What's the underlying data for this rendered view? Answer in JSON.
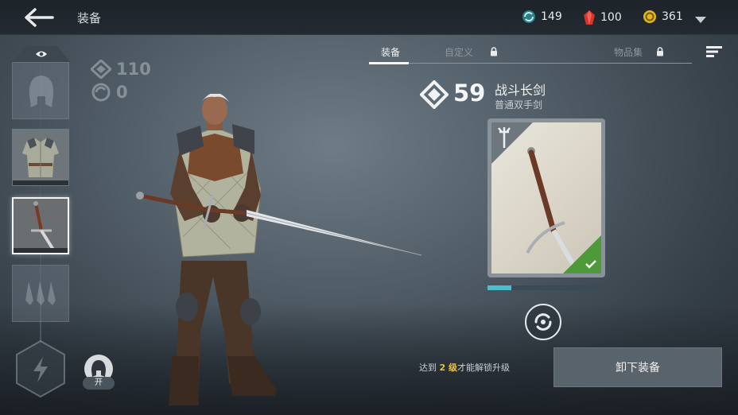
{
  "header": {
    "title": "装备",
    "currencies": [
      {
        "icon": "energy-orb-icon",
        "value": "149",
        "color": "#3aa6b0"
      },
      {
        "icon": "ruby-gem-icon",
        "value": "100",
        "color": "#d8342c"
      },
      {
        "icon": "gold-coin-icon",
        "value": "361",
        "color": "#e2b71e"
      }
    ]
  },
  "left_panel": {
    "stats": {
      "power": "110",
      "upgrade": "0"
    },
    "helmet_toggle_label": "开"
  },
  "tabs": [
    {
      "label": "装备",
      "active": true,
      "locked": false
    },
    {
      "label": "自定义",
      "active": false,
      "locked": true
    },
    {
      "label": "物品集",
      "active": false,
      "locked": true
    }
  ],
  "item": {
    "power": "59",
    "name": "战斗长剑",
    "type": "普通双手剑",
    "progress": 0.2,
    "equipped": true
  },
  "unlock_message": {
    "prefix": "达到",
    "level": "2 级",
    "suffix": "才能解锁升级"
  },
  "actions": {
    "unequip_label": "卸下装备"
  },
  "colors": {
    "accent_teal": "#4fbccc",
    "level_gold": "#f0c232",
    "equipped_green": "#4e9a3a"
  }
}
